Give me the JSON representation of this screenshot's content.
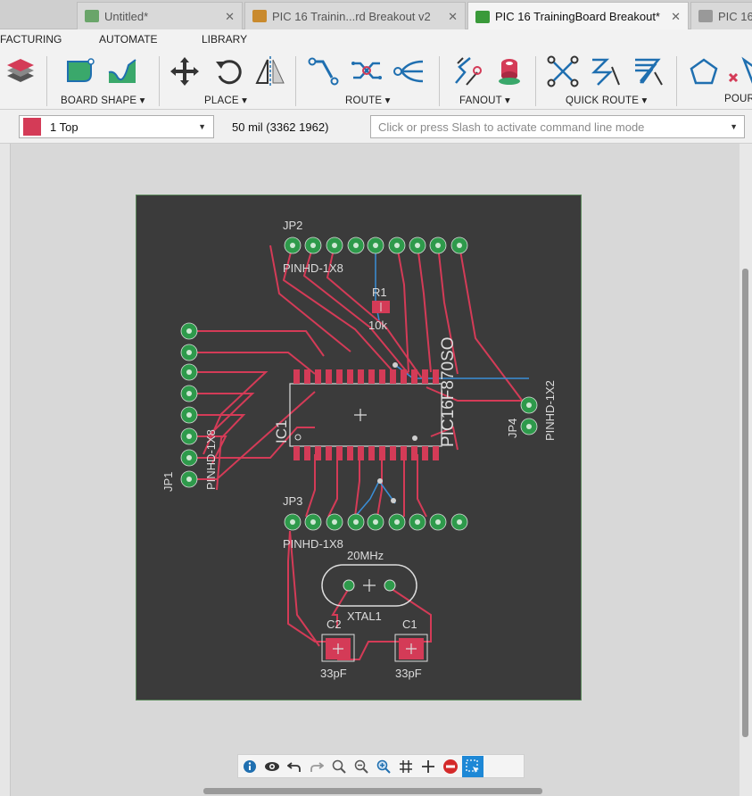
{
  "tabs": [
    {
      "label": "Untitled*",
      "close": "✕"
    },
    {
      "label": "PIC 16 Trainin...rd Breakout v2",
      "close": "✕"
    },
    {
      "label": "PIC 16 TrainingBoard Breakout*",
      "close": "✕"
    },
    {
      "label": "PIC 16",
      "close": ""
    }
  ],
  "menu": {
    "manufacturing": "FACTURING",
    "automate": "AUTOMATE",
    "library": "LIBRARY"
  },
  "toolbar_groups": {
    "board_shape": "BOARD SHAPE ▾",
    "place": "PLACE ▾",
    "route": "ROUTE ▾",
    "fanout": "FANOUT ▾",
    "quick_route": "QUICK ROUTE ▾",
    "pour": "POUR"
  },
  "layer": {
    "name": "1 Top",
    "color": "#d43b57"
  },
  "grid_readout": "50 mil (3362 1962)",
  "command": {
    "placeholder": "Click or press Slash to activate command line mode"
  },
  "board": {
    "labels": {
      "jp2": "JP2",
      "jp2_part": "PINHD-1X8",
      "r1": "R1",
      "r1_val": "10k",
      "ic_part": "PIC16F870SO",
      "ic1": "IC1",
      "jp4": "JP4",
      "jp4_part": "PINHD-1X2",
      "jp1": "JP1",
      "jp1_part": "PINHD-1X8",
      "jp3": "JP3",
      "jp3_part": "PINHD-1X8",
      "xtal_val": "20MHz",
      "xtal": "XTAL1",
      "c2": "C2",
      "c1": "C1",
      "c2_val": "33pF",
      "c1_val": "33pF"
    },
    "colors": {
      "board": "#3b3b3b",
      "copper_top": "#d43b57",
      "copper_bottom": "#3a8fd8",
      "pad": "#2e9a4b",
      "silk": "#dcdcdc"
    }
  },
  "bottom_tools": [
    "info-icon",
    "eye-icon",
    "undo-icon",
    "redo-icon",
    "zoom-fit-icon",
    "zoom-out-icon",
    "zoom-in-icon",
    "grid-icon",
    "crosshair-icon",
    "stop-icon",
    "select-icon"
  ]
}
